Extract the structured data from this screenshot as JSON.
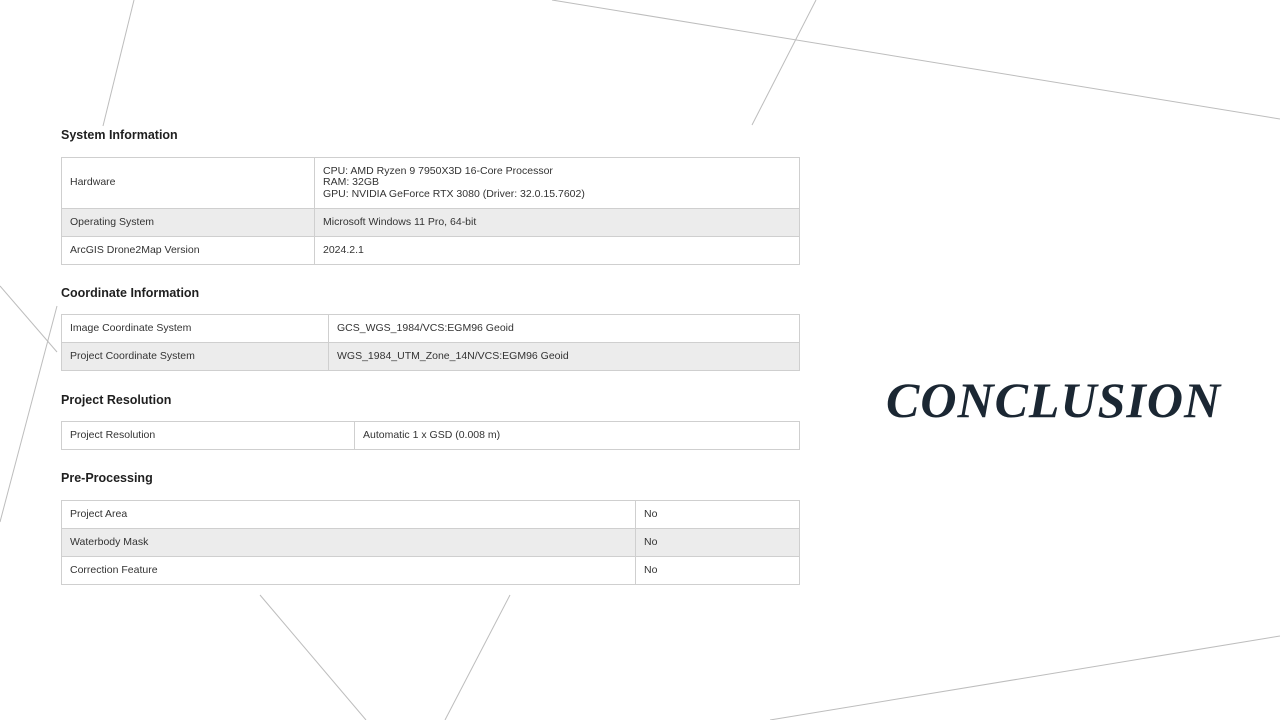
{
  "slide": {
    "title": "CONCLUSION"
  },
  "system": {
    "heading": "System Information",
    "hardware_label": "Hardware",
    "hardware_lines": [
      "CPU: AMD Ryzen 9 7950X3D 16-Core Processor",
      "RAM: 32GB",
      "GPU: NVIDIA GeForce RTX 3080 (Driver: 32.0.15.7602)"
    ],
    "os_label": "Operating System",
    "os_value": "Microsoft Windows 11 Pro, 64-bit",
    "version_label": "ArcGIS Drone2Map Version",
    "version_value": "2024.2.1"
  },
  "coordinate": {
    "heading": "Coordinate Information",
    "rows": [
      {
        "label": "Image Coordinate System",
        "value": "GCS_WGS_1984/VCS:EGM96 Geoid"
      },
      {
        "label": "Project Coordinate System",
        "value": "WGS_1984_UTM_Zone_14N/VCS:EGM96 Geoid"
      }
    ]
  },
  "resolution": {
    "heading": "Project Resolution",
    "rows": [
      {
        "label": "Project Resolution",
        "value": "Automatic 1 x GSD (0.008 m)"
      }
    ]
  },
  "preprocessing": {
    "heading": "Pre-Processing",
    "rows": [
      {
        "label": "Project Area",
        "value": "No"
      },
      {
        "label": "Waterbody Mask",
        "value": "No"
      },
      {
        "label": "Correction Feature",
        "value": "No"
      }
    ]
  },
  "colors": {
    "background": "#ffffff",
    "table_border": "#cfcfcf",
    "alt_row": "#ececec",
    "title": "#1b2733",
    "decorative_line": "#bdbdbd"
  }
}
